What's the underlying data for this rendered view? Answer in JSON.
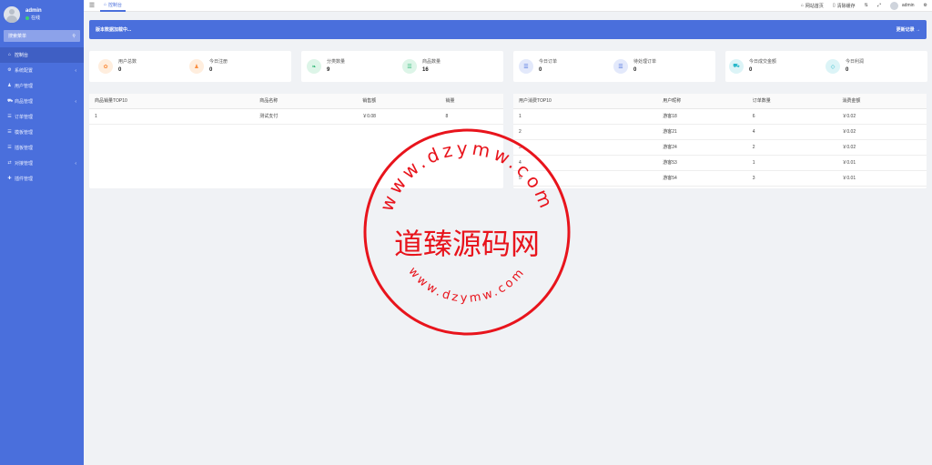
{
  "sidebar": {
    "user_name": "admin",
    "user_status": "在线",
    "search_label": "搜索菜单",
    "items": [
      {
        "label": "控制台",
        "icon": "dashboard-icon",
        "glyph": "⌂",
        "arrow": ""
      },
      {
        "label": "系统配置",
        "icon": "gear-icon",
        "glyph": "⚙",
        "arrow": "‹"
      },
      {
        "label": "用户管理",
        "icon": "user-icon",
        "glyph": "♟",
        "arrow": ""
      },
      {
        "label": "商品管理",
        "icon": "cart-icon",
        "glyph": "⛟",
        "arrow": "‹"
      },
      {
        "label": "订单管理",
        "icon": "list-icon",
        "glyph": "☰",
        "arrow": ""
      },
      {
        "label": "模板管理",
        "icon": "template-icon",
        "glyph": "☰",
        "arrow": ""
      },
      {
        "label": "插板管理",
        "icon": "plugin-icon",
        "glyph": "☰",
        "arrow": ""
      },
      {
        "label": "对接管理",
        "icon": "link-icon",
        "glyph": "⇄",
        "arrow": "‹"
      },
      {
        "label": "插件管理",
        "icon": "puzzle-icon",
        "glyph": "✚",
        "arrow": ""
      }
    ]
  },
  "header": {
    "tab_label": "控制台",
    "right": {
      "website_home": "网站首页",
      "clear_cache": "清除缓存",
      "admin": "admin"
    }
  },
  "banner": {
    "title": "版本数据加载中...",
    "link": "更新记录 →"
  },
  "stats": [
    {
      "label": "用户总数",
      "value": "0",
      "icon": "users-icon",
      "glyph": "✿",
      "color": "#fb8c3c",
      "bg": "#ffeede"
    },
    {
      "label": "今日注册",
      "value": "0",
      "icon": "person-icon",
      "glyph": "♟",
      "color": "#fb8c3c",
      "bg": "#ffeede"
    },
    {
      "label": "分类数量",
      "value": "9",
      "icon": "leaf-icon",
      "glyph": "❧",
      "color": "#2bb673",
      "bg": "#ddf5e8"
    },
    {
      "label": "商品数量",
      "value": "16",
      "icon": "list-icon",
      "glyph": "☰",
      "color": "#2bb673",
      "bg": "#ddf5e8"
    },
    {
      "label": "今日订单",
      "value": "0",
      "icon": "order-icon",
      "glyph": "☰",
      "color": "#4a6fdc",
      "bg": "#e3e9fb"
    },
    {
      "label": "待处理订单",
      "value": "0",
      "icon": "pending-icon",
      "glyph": "☰",
      "color": "#4a6fdc",
      "bg": "#e3e9fb"
    },
    {
      "label": "今日成交金额",
      "value": "0",
      "icon": "cart-icon",
      "glyph": "⛟",
      "color": "#27b7c9",
      "bg": "#dcf4f7"
    },
    {
      "label": "今日利润",
      "value": "0",
      "icon": "diamond-icon",
      "glyph": "◇",
      "color": "#27b7c9",
      "bg": "#dcf4f7"
    }
  ],
  "product_table": {
    "headers": [
      "商品销量TOP10",
      "商品名称",
      "销售额",
      "销量"
    ],
    "rows": [
      [
        "1",
        "测试支付",
        "￥0.08",
        "8"
      ]
    ]
  },
  "user_table": {
    "headers": [
      "用户消费TOP10",
      "用户昵称",
      "订单数量",
      "消费金额"
    ],
    "rows": [
      [
        "1",
        "游客18",
        "6",
        "￥0.02"
      ],
      [
        "2",
        "游客21",
        "4",
        "￥0.02"
      ],
      [
        "3",
        "游客24",
        "2",
        "￥0.02"
      ],
      [
        "4",
        "游客53",
        "1",
        "￥0.01"
      ],
      [
        "5",
        "游客54",
        "3",
        "￥0.01"
      ]
    ]
  },
  "watermark": {
    "center": "道臻源码网",
    "ring": "www.dzymw.com"
  }
}
